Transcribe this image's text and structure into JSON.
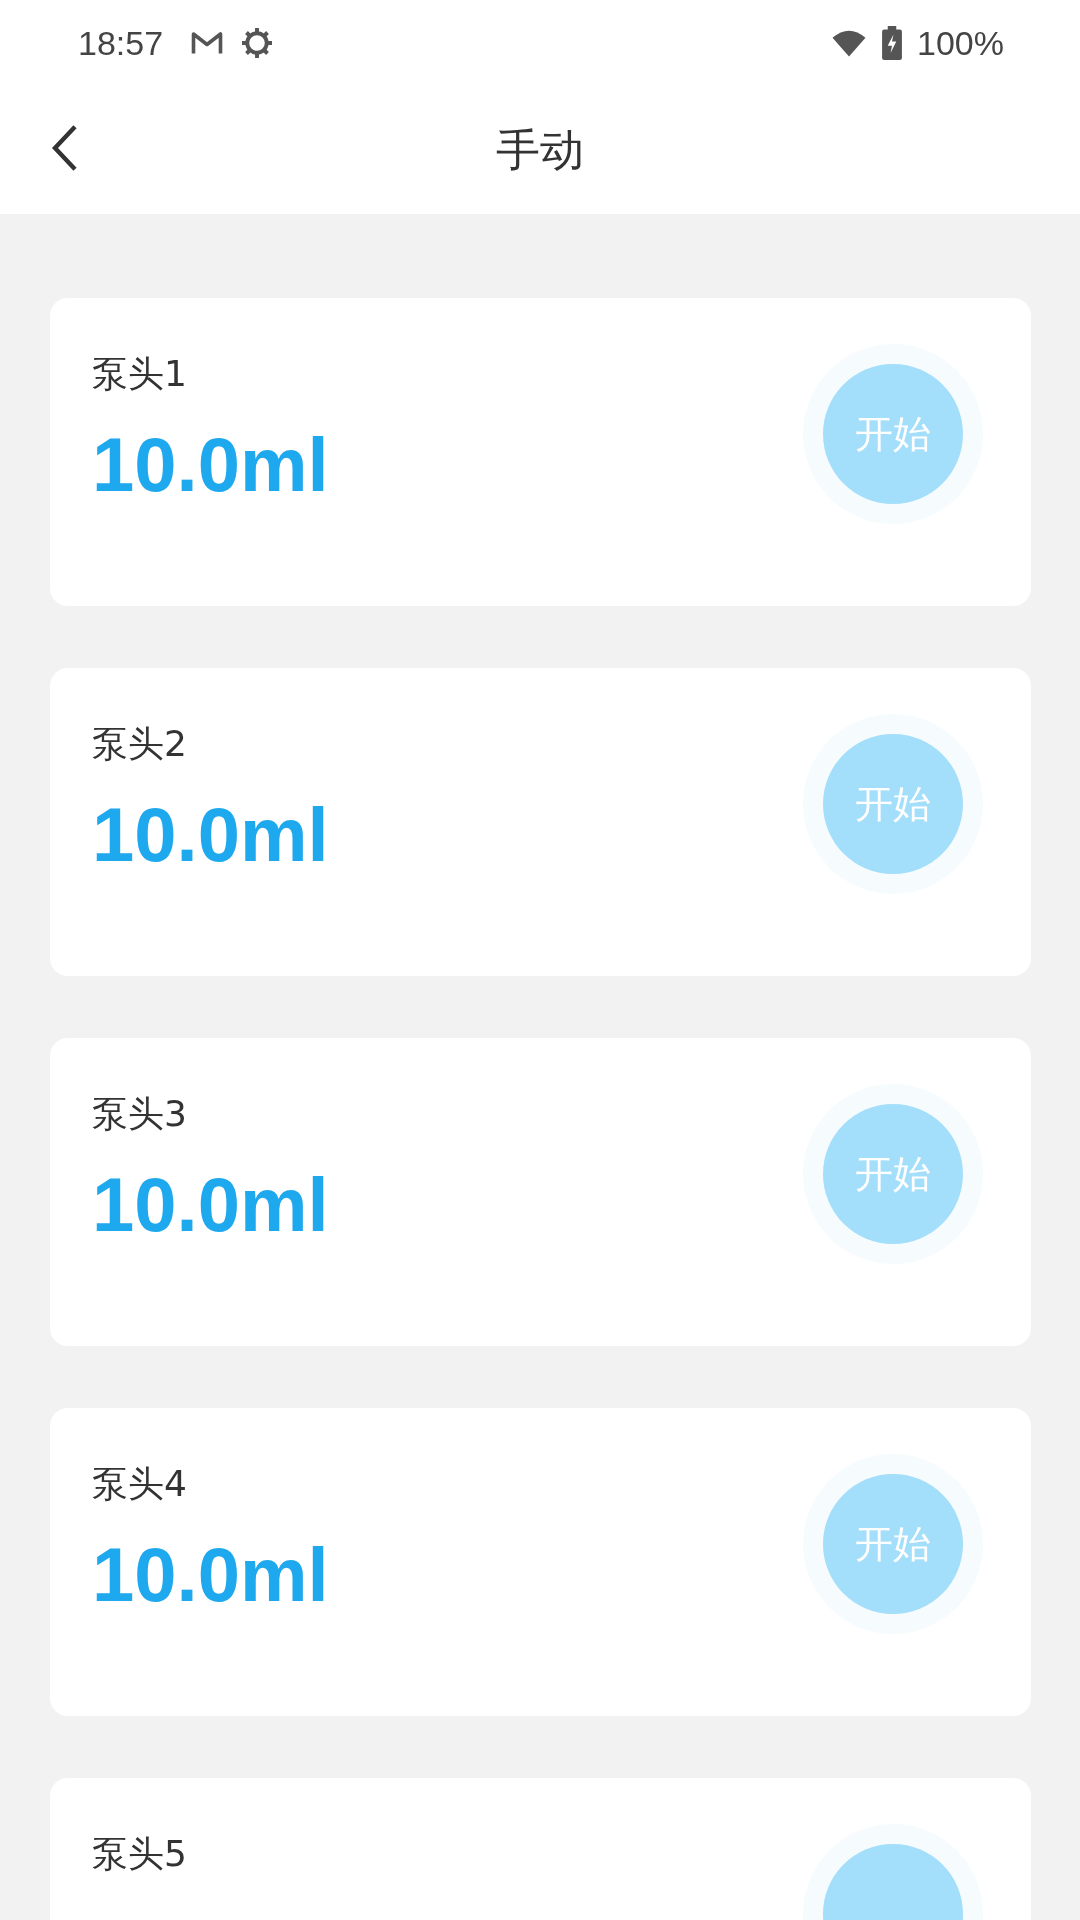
{
  "status_bar": {
    "time": "18:57",
    "battery": "100%"
  },
  "header": {
    "title": "手动"
  },
  "pumps": [
    {
      "label": "泵头1",
      "value": "10.0ml",
      "button": "开始"
    },
    {
      "label": "泵头2",
      "value": "10.0ml",
      "button": "开始"
    },
    {
      "label": "泵头3",
      "value": "10.0ml",
      "button": "开始"
    },
    {
      "label": "泵头4",
      "value": "10.0ml",
      "button": "开始"
    },
    {
      "label": "泵头5"
    }
  ]
}
